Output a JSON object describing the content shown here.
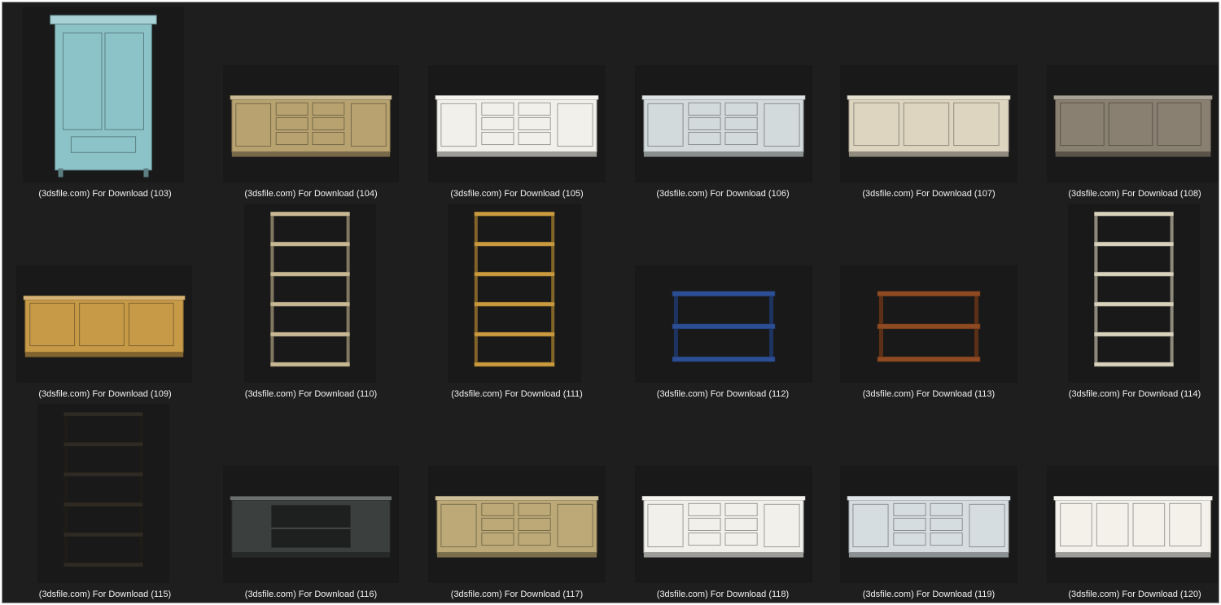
{
  "files": [
    {
      "label": "(3dsfile.com) For Download (103)",
      "type": "wardrobe",
      "color": "#8cc3c9"
    },
    {
      "label": "(3dsfile.com) For Download (104)",
      "type": "drawer-cabinet",
      "color": "#b7a270"
    },
    {
      "label": "(3dsfile.com) For Download (105)",
      "type": "drawer-cabinet",
      "color": "#f2f0ea"
    },
    {
      "label": "(3dsfile.com) For Download (106)",
      "type": "drawer-cabinet",
      "color": "#d3dadc"
    },
    {
      "label": "(3dsfile.com) For Download (107)",
      "type": "sideboard",
      "color": "#ddd5c0"
    },
    {
      "label": "(3dsfile.com) For Download (108)",
      "type": "sideboard",
      "color": "#8a8072"
    },
    {
      "label": "(3dsfile.com) For Download (109)",
      "type": "sideboard",
      "color": "#c79a48"
    },
    {
      "label": "(3dsfile.com) For Download (110)",
      "type": "tall-shelf",
      "color": "#c8b994"
    },
    {
      "label": "(3dsfile.com) For Download (111)",
      "type": "tall-shelf",
      "color": "#c99a3e"
    },
    {
      "label": "(3dsfile.com) For Download (112)",
      "type": "low-shelf",
      "color": "#2c4e94"
    },
    {
      "label": "(3dsfile.com) For Download (113)",
      "type": "low-shelf",
      "color": "#8e4a22"
    },
    {
      "label": "(3dsfile.com) For Download (114)",
      "type": "tall-shelf",
      "color": "#d9d2bd"
    },
    {
      "label": "(3dsfile.com) For Download (115)",
      "type": "tall-shelf",
      "color": "#2f2b24"
    },
    {
      "label": "(3dsfile.com) For Download (116)",
      "type": "media-console",
      "color": "#3b3f3d"
    },
    {
      "label": "(3dsfile.com) For Download (117)",
      "type": "drawer-cabinet",
      "color": "#bca977"
    },
    {
      "label": "(3dsfile.com) For Download (118)",
      "type": "drawer-cabinet",
      "color": "#f1f0eb"
    },
    {
      "label": "(3dsfile.com) For Download (119)",
      "type": "drawer-cabinet",
      "color": "#d6dde0"
    },
    {
      "label": "(3dsfile.com) For Download (120)",
      "type": "breakfront",
      "color": "#f3f1ea"
    }
  ]
}
